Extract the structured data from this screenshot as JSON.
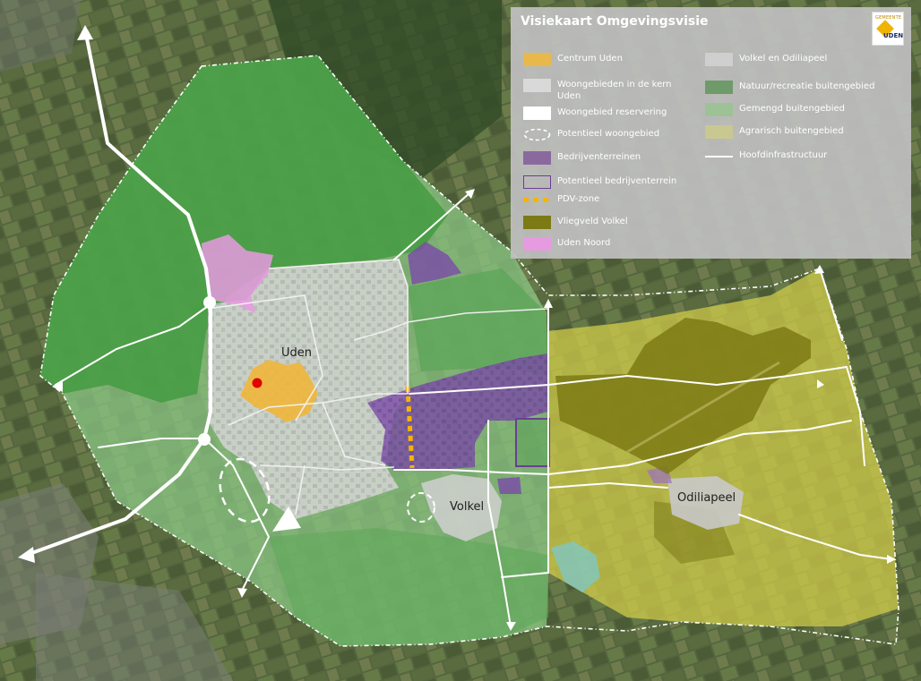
{
  "legend": {
    "title": "Visiekaart Omgevingsvisie",
    "logo": {
      "small_text": "GEMEENTE",
      "name": "UDEN"
    },
    "items_left": [
      {
        "label": "Centrum Uden",
        "swatch": "fill",
        "color": "#e8b84a"
      },
      {
        "label": "Woongebieden in de kern Uden",
        "swatch": "fill",
        "color": "#d9d9d9"
      },
      {
        "label": "Woongebied reservering",
        "swatch": "fill",
        "color": "#ffffff"
      },
      {
        "label": "Potentieel woongebied",
        "swatch": "dashed-ellipse",
        "color": "#ffffff"
      },
      {
        "label": "Bedrijventerreinen",
        "swatch": "fill",
        "color": "#8a6a9e"
      },
      {
        "label": "Potentieel bedrijventerrein",
        "swatch": "outline",
        "color": "#6a3e96"
      },
      {
        "label": "PDV-zone",
        "swatch": "dashed-line",
        "color": "#f5b400"
      },
      {
        "label": "Vliegveld Volkel",
        "swatch": "fill",
        "color": "#7c7a14"
      },
      {
        "label": "Uden Noord",
        "swatch": "fill",
        "color": "#e69ae0"
      }
    ],
    "items_right": [
      {
        "label": "Volkel en Odiliapeel",
        "swatch": "fill",
        "color": "#cfcfcf"
      },
      {
        "label": "Natuur/recreatie buitengebied",
        "swatch": "fill",
        "color": "#6f9a6a"
      },
      {
        "label": "Gemengd buitengebied",
        "swatch": "fill",
        "color": "#9cc296"
      },
      {
        "label": "Agrarisch buitengebied",
        "swatch": "fill",
        "color": "#c9c890"
      },
      {
        "label": "Hoofdinfrastructuur",
        "swatch": "line",
        "color": "#ffffff"
      }
    ]
  },
  "places": {
    "uden": "Uden",
    "volkel": "Volkel",
    "odiliapeel": "Odiliapeel"
  },
  "colors": {
    "aerial_base": "#4a5a3a",
    "nature": "#3f9a3c",
    "mixed": "#7fc27a",
    "agricultural": "#cfcb4c",
    "residential": "#cfcfcf",
    "center": "#f0b63a",
    "business": "#7a4aa8",
    "airfield": "#8a8200",
    "uden_noord": "#e69ae0",
    "marker": "#e00000"
  }
}
